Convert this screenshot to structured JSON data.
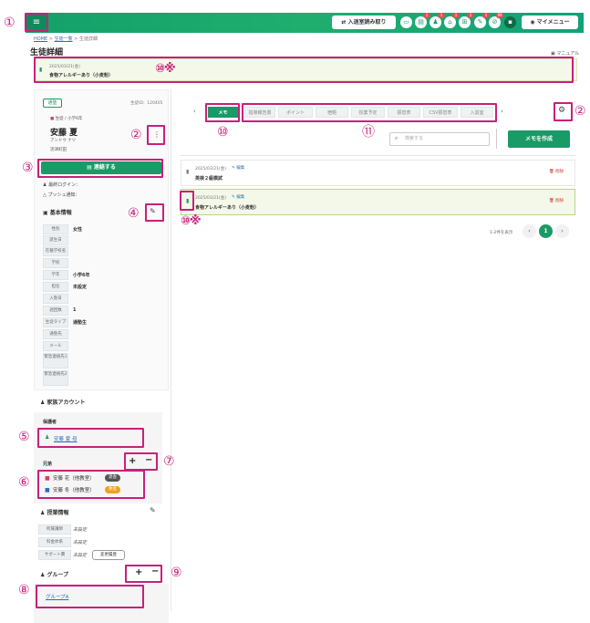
{
  "header": {
    "menu_icon": "≡",
    "entry_button_label": "入退室読み取り",
    "icons": [
      {
        "name": "chat-icon",
        "glyph": "▭",
        "badge": ""
      },
      {
        "name": "document-icon",
        "glyph": "▤",
        "badge": "1"
      },
      {
        "name": "people-icon",
        "glyph": "♟",
        "badge": "1"
      },
      {
        "name": "school-icon",
        "glyph": "⌂",
        "badge": "1"
      },
      {
        "name": "store-icon",
        "glyph": "⊞",
        "badge": "1"
      },
      {
        "name": "tool-icon",
        "glyph": "✎",
        "badge": "1"
      },
      {
        "name": "link-icon",
        "glyph": "⊘",
        "badge": "99"
      },
      {
        "name": "message-icon",
        "glyph": "▪",
        "badge": ""
      }
    ],
    "mymenu_label": "マイメニュー",
    "mymenu_icon": "◉"
  },
  "breadcrumb": {
    "home": "HOME",
    "list": "生徒一覧",
    "current": "生徒詳細",
    "sep": ">"
  },
  "page": {
    "title": "生徒詳細",
    "manual": "マニュアル"
  },
  "banner_memo": {
    "date": "2025/03/21(金)",
    "text": "食物アレルギーあり（小麦粉）"
  },
  "student": {
    "status": "通塾",
    "id_label": "生徒ID：120405",
    "role": "生徒 / 小学6年",
    "name": "安藤 夏",
    "kana": "アンドウ ナツ",
    "school": "流津町田"
  },
  "contact_button": "連絡する",
  "login": {
    "last_login": "最終ログイン：",
    "push": "プッシュ通知："
  },
  "basic_info": {
    "title": "基本情報",
    "rows": [
      {
        "label": "性別",
        "value": "女性"
      },
      {
        "label": "誕生日",
        "value": ""
      },
      {
        "label": "在籍学校名",
        "value": ""
      },
      {
        "label": "学校",
        "value": ""
      },
      {
        "label": "学年",
        "value": "小学6年"
      },
      {
        "label": "担任",
        "value": "未設定"
      },
      {
        "label": "入塾日",
        "value": ""
      },
      {
        "label": "週回数",
        "value": "1"
      },
      {
        "label": "生徒タイプ",
        "value": "通塾生"
      },
      {
        "label": "通塾先",
        "value": ""
      },
      {
        "label": "メール",
        "value": ""
      },
      {
        "label": "緊急連絡先1",
        "value": ""
      },
      {
        "label": "緊急連絡先2",
        "value": ""
      }
    ]
  },
  "family": {
    "title": "家族アカウント",
    "guardian_label": "保護者",
    "guardian_name": "安藤 夏 母",
    "siblings_label": "兄弟",
    "siblings": [
      {
        "name": "安藤 花（他教室）",
        "badge": "退会",
        "color": "#555555"
      },
      {
        "name": "安藤 冬（他教室）",
        "badge": "休会",
        "color": "#f0a020"
      }
    ]
  },
  "class_info": {
    "title": "授業情報",
    "rows": [
      {
        "label": "所属講師",
        "value": "未設定"
      },
      {
        "label": "料金体系",
        "value": "未設定"
      },
      {
        "label": "サポート費",
        "value": "未設定"
      }
    ],
    "history_button": "変更履歴"
  },
  "group": {
    "title": "グループ",
    "link": "グループA"
  },
  "tabs": [
    "メモ",
    "指導報告書",
    "ポイント",
    "宿題",
    "授業予定",
    "振替表",
    "CSV振替表",
    "入退室"
  ],
  "search": {
    "placeholder": "検索する"
  },
  "create_memo_button": "メモを作成",
  "memos": [
    {
      "date": "2025/03/21(金)",
      "edit": "編集",
      "text": "英検２級模試",
      "delete": "削除"
    },
    {
      "date": "2025/03/21(金)",
      "edit": "編集",
      "text": "食物アレルギーあり（小麦粉）",
      "delete": "削除"
    }
  ],
  "pager": {
    "info": "1-2件を表示",
    "current": "1",
    "prev": "‹",
    "next": "›"
  },
  "annotations": {
    "n1": "①",
    "n2": "②",
    "n3": "③",
    "n4": "④",
    "n5": "⑤",
    "n6": "⑥",
    "n7": "⑦",
    "n8": "⑧",
    "n9": "⑨",
    "n10": "⑩",
    "n11": "⑪",
    "mark": "※"
  },
  "colors": {
    "brand": "#1a9a66",
    "annotation": "#c8207a",
    "link": "#2a6fb5",
    "delete": "#d03030"
  }
}
